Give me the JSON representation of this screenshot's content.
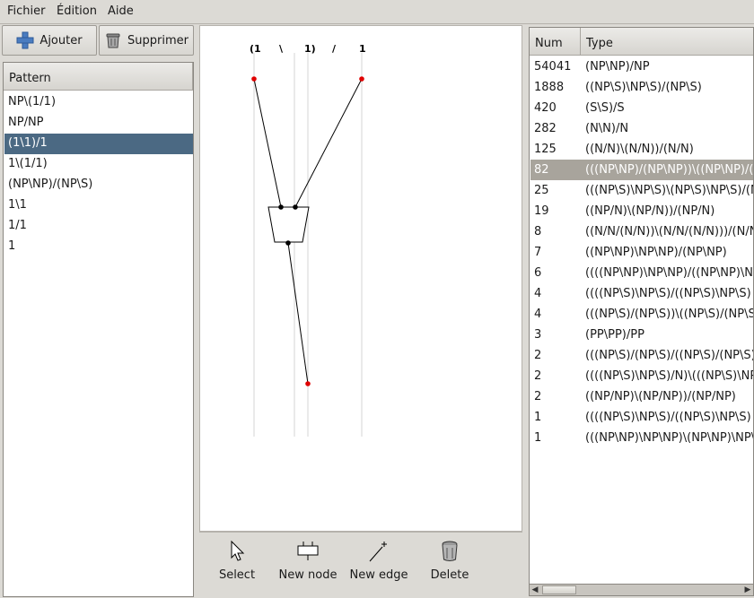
{
  "menu": {
    "file": "Fichier",
    "edit": "Édition",
    "help": "Aide"
  },
  "left": {
    "add_label": "Ajouter",
    "delete_label": "Supprimer",
    "pattern_header": "Pattern",
    "patterns": [
      "NP\\(1/1)",
      "NP/NP",
      "(1\\1)/1",
      "1\\(1/1)",
      "(NP\\NP)/(NP\\S)",
      "1\\1",
      "1/1",
      "1"
    ],
    "selected_index": 2
  },
  "canvas": {
    "tokens": [
      "(1",
      "\\",
      "1)",
      "/",
      "1"
    ]
  },
  "tools": {
    "select": "Select",
    "new_node": "New node",
    "new_edge": "New edge",
    "delete": "Delete"
  },
  "right": {
    "num_header": "Num",
    "type_header": "Type",
    "selected_index": 5,
    "rows": [
      {
        "num": "54041",
        "type": "(NP\\NP)/NP"
      },
      {
        "num": "1888",
        "type": "((NP\\S)\\NP\\S)/(NP\\S)"
      },
      {
        "num": "420",
        "type": "(S\\S)/S"
      },
      {
        "num": "282",
        "type": "(N\\N)/N"
      },
      {
        "num": "125",
        "type": "((N/N)\\(N/N))/(N/N)"
      },
      {
        "num": "82",
        "type": "(((NP\\NP)/(NP\\NP))\\((NP\\NP)/(NP\\NP)))"
      },
      {
        "num": "25",
        "type": "(((NP\\S)\\NP\\S)\\(NP\\S)\\NP\\S)/(NP\\S)"
      },
      {
        "num": "19",
        "type": "((NP/N)\\(NP/N))/(NP/N)"
      },
      {
        "num": "8",
        "type": "((N/N/(N/N))\\(N/N/(N/N)))/(N/N)"
      },
      {
        "num": "7",
        "type": "((NP\\NP)\\NP\\NP)/(NP\\NP)"
      },
      {
        "num": "6",
        "type": "((((NP\\NP)\\NP\\NP)/((NP\\NP)\\NP\\NP)"
      },
      {
        "num": "4",
        "type": "((((NP\\S)\\NP\\S)/((NP\\S)\\NP\\S)"
      },
      {
        "num": "4",
        "type": "(((NP\\S)/(NP\\S))\\((NP\\S)/(NP\\S)"
      },
      {
        "num": "3",
        "type": "(PP\\PP)/PP"
      },
      {
        "num": "2",
        "type": "(((NP\\S)/(NP\\S)/((NP\\S)/(NP\\S)"
      },
      {
        "num": "2",
        "type": "((((NP\\S)\\NP\\S)/N)\\(((NP\\S)\\NP\\S)"
      },
      {
        "num": "2",
        "type": "((NP/NP)\\(NP/NP))/(NP/NP)"
      },
      {
        "num": "1",
        "type": "((((NP\\S)\\NP\\S)/((NP\\S)\\NP\\S)"
      },
      {
        "num": "1",
        "type": "(((NP\\NP)\\NP\\NP)\\(NP\\NP)\\NP\\NP)"
      }
    ]
  },
  "colors": {
    "selected_pattern": "#4b6983",
    "selected_type": "#a8a49c",
    "endpoint": "#e00000"
  }
}
